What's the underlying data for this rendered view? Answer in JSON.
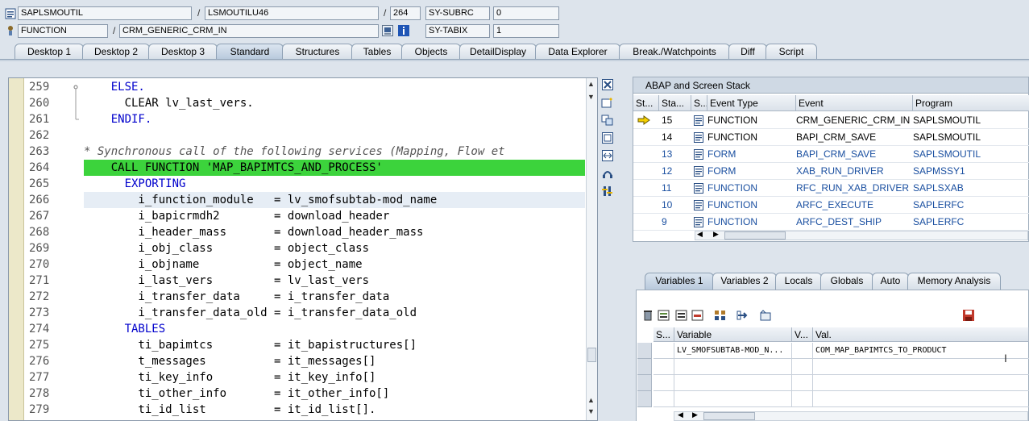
{
  "header": {
    "row1": {
      "program": "SAPLSMOUTIL",
      "include": "LSMOUTILU46",
      "line": "264",
      "sys_field_label": "SY-SUBRC",
      "sys_field_value": "0"
    },
    "row2": {
      "event_type": "FUNCTION",
      "event": "CRM_GENERIC_CRM_IN",
      "sys_field_label": "SY-TABIX",
      "sys_field_value": "1"
    },
    "separator": "/"
  },
  "tabs": [
    {
      "label": "Desktop 1"
    },
    {
      "label": "Desktop 2"
    },
    {
      "label": "Desktop 3"
    },
    {
      "label": "Standard",
      "active": true
    },
    {
      "label": "Structures"
    },
    {
      "label": "Tables"
    },
    {
      "label": "Objects"
    },
    {
      "label": "DetailDisplay"
    },
    {
      "label": "Data Explorer"
    },
    {
      "label": "Break./Watchpoints"
    },
    {
      "label": "Diff"
    },
    {
      "label": "Script"
    }
  ],
  "code": {
    "lines": [
      {
        "no": "259",
        "text": "    ELSE.",
        "kind": "kw"
      },
      {
        "no": "260",
        "text": "      CLEAR lv_last_vers.",
        "kind": "mixed"
      },
      {
        "no": "261",
        "text": "    ENDIF.",
        "kind": "kw"
      },
      {
        "no": "262",
        "text": "",
        "kind": "plain"
      },
      {
        "no": "263",
        "text": "* Synchronous call of the following services (Mapping, Flow et",
        "kind": "cmt"
      },
      {
        "no": "264",
        "text": "    CALL FUNCTION 'MAP_BAPIMTCS_AND_PROCESS'",
        "kind": "hl"
      },
      {
        "no": "265",
        "text": "      EXPORTING",
        "kind": "kw"
      },
      {
        "no": "266",
        "text": "        i_function_module   = lv_smofsubtab-mod_name",
        "kind": "cur"
      },
      {
        "no": "267",
        "text": "        i_bapicrmdh2        = download_header",
        "kind": "plain"
      },
      {
        "no": "268",
        "text": "        i_header_mass       = download_header_mass",
        "kind": "plain"
      },
      {
        "no": "269",
        "text": "        i_obj_class         = object_class",
        "kind": "plain"
      },
      {
        "no": "270",
        "text": "        i_objname           = object_name",
        "kind": "plain"
      },
      {
        "no": "271",
        "text": "        i_last_vers         = lv_last_vers",
        "kind": "plain"
      },
      {
        "no": "272",
        "text": "        i_transfer_data     = i_transfer_data",
        "kind": "plain"
      },
      {
        "no": "273",
        "text": "        i_transfer_data_old = i_transfer_data_old",
        "kind": "plain"
      },
      {
        "no": "274",
        "text": "      TABLES",
        "kind": "kw"
      },
      {
        "no": "275",
        "text": "        ti_bapimtcs         = it_bapistructures[]",
        "kind": "plain"
      },
      {
        "no": "276",
        "text": "        t_messages          = it_messages[]",
        "kind": "plain"
      },
      {
        "no": "277",
        "text": "        ti_key_info         = it_key_info[]",
        "kind": "plain"
      },
      {
        "no": "278",
        "text": "        ti_other_info       = it_other_info[]",
        "kind": "plain"
      },
      {
        "no": "279",
        "text": "        ti_id_list          = it_id_list[].",
        "kind": "plain"
      }
    ]
  },
  "stack": {
    "title": "ABAP and Screen Stack",
    "columns": [
      "St...",
      "Sta...",
      "S...",
      "Event Type",
      "Event",
      "Program"
    ],
    "rows": [
      {
        "level": "15",
        "event_type": "FUNCTION",
        "event": "CRM_GENERIC_CRM_IN",
        "program": "SAPLSMOUTIL",
        "current": true
      },
      {
        "level": "14",
        "event_type": "FUNCTION",
        "event": "BAPI_CRM_SAVE",
        "program": "SAPLSMOUTIL",
        "current": false
      },
      {
        "level": "13",
        "event_type": "FORM",
        "event": "BAPI_CRM_SAVE",
        "program": "SAPLSMOUTIL",
        "current": false
      },
      {
        "level": "12",
        "event_type": "FORM",
        "event": "XAB_RUN_DRIVER",
        "program": "SAPMSSY1",
        "current": false
      },
      {
        "level": "11",
        "event_type": "FUNCTION",
        "event": "RFC_RUN_XAB_DRIVER",
        "program": "SAPLSXAB",
        "current": false
      },
      {
        "level": "10",
        "event_type": "FUNCTION",
        "event": "ARFC_EXECUTE",
        "program": "SAPLERFC",
        "current": false
      },
      {
        "level": "9",
        "event_type": "FUNCTION",
        "event": "ARFC_DEST_SHIP",
        "program": "SAPLERFC",
        "current": false
      }
    ]
  },
  "variables": {
    "tabs": [
      {
        "label": "Variables 1",
        "active": true
      },
      {
        "label": "Variables 2"
      },
      {
        "label": "Locals"
      },
      {
        "label": "Globals"
      },
      {
        "label": "Auto"
      },
      {
        "label": "Memory Analysis"
      }
    ],
    "columns": [
      "S...",
      "Variable",
      "V...",
      "Val."
    ],
    "rows": [
      {
        "variable": "LV_SMOFSUBTAB-MOD_N...",
        "value": "COM_MAP_BAPIMTCS_TO_PRODUCT"
      }
    ]
  },
  "colors": {
    "accent": "#3cd33c",
    "keyword": "#0000cc",
    "breakpoint": "#d43a1a"
  }
}
